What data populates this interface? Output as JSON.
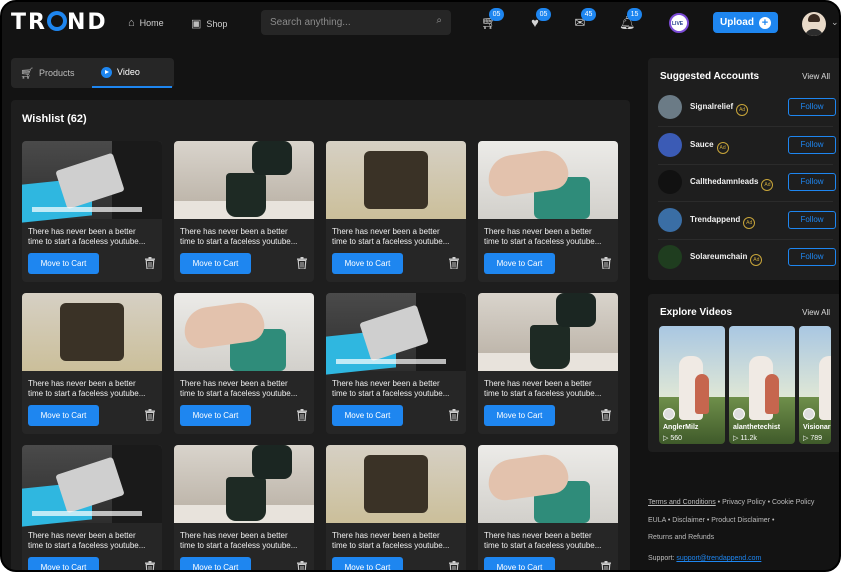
{
  "header": {
    "logo": "TREND",
    "nav": [
      {
        "label": "Home",
        "icon": "home-icon"
      },
      {
        "label": "Shop",
        "icon": "shop-icon"
      }
    ],
    "search_placeholder": "Search anything...",
    "icons": [
      {
        "name": "cart-icon",
        "badge": "05"
      },
      {
        "name": "heart-icon",
        "badge": "05"
      },
      {
        "name": "mail-icon",
        "badge": "45"
      },
      {
        "name": "bell-icon",
        "badge": "15"
      }
    ],
    "live_label": "LIVE",
    "upload_label": "Upload"
  },
  "tabs": [
    {
      "label": "Products",
      "active": false
    },
    {
      "label": "Video",
      "active": true
    }
  ],
  "wishlist": {
    "title": "Wishlist (62)",
    "cards": [
      {
        "thumb": "atm",
        "line1": "There has never been a better",
        "line2": "time to start a faceless youtube...",
        "button": "Move to Cart"
      },
      {
        "thumb": "pour",
        "line1": "There has never been a better",
        "line2": "time to start a faceless youtube...",
        "button": "Move to Cart"
      },
      {
        "thumb": "box",
        "line1": "There has never been a better",
        "line2": "time to start a faceless youtube...",
        "button": "Move to Cart"
      },
      {
        "thumb": "jar",
        "line1": "There has never been a better",
        "line2": "time to start a faceless youtube...",
        "button": "Move to Cart"
      },
      {
        "thumb": "box",
        "line1": "There has never been a better",
        "line2": "time to start a faceless youtube...",
        "button": "Move to Cart"
      },
      {
        "thumb": "jar",
        "line1": "There has never been a better",
        "line2": "time to start a faceless youtube...",
        "button": "Move to Cart"
      },
      {
        "thumb": "atm",
        "line1": "There has never been a better",
        "line2": "time to start a faceless youtube...",
        "button": "Move to Cart"
      },
      {
        "thumb": "pour",
        "line1": "There has never been a better",
        "line2": "time to start a faceless youtube...",
        "button": "Move to Cart"
      },
      {
        "thumb": "atm",
        "line1": "There has never been a better",
        "line2": "time to start a faceless youtube...",
        "button": "Move to Cart"
      },
      {
        "thumb": "pour",
        "line1": "There has never been a better",
        "line2": "time to start a faceless youtube...",
        "button": "Move to Cart"
      },
      {
        "thumb": "box",
        "line1": "There has never been a better",
        "line2": "time to start a faceless youtube...",
        "button": "Move to Cart"
      },
      {
        "thumb": "jar",
        "line1": "There has never been a better",
        "line2": "time to start a faceless youtube...",
        "button": "Move to Cart"
      }
    ]
  },
  "suggested": {
    "title": "Suggested Accounts",
    "view_all": "View All",
    "ad_label": "Ad",
    "follow_label": "Follow",
    "accounts": [
      {
        "name": "Signalrelief",
        "color": "#6b7b86"
      },
      {
        "name": "Sauce",
        "color": "#3b5bb5"
      },
      {
        "name": "Callthedamnleads",
        "color": "#111111"
      },
      {
        "name": "Trendappend",
        "color": "#3a6ea5"
      },
      {
        "name": "Solareumchain",
        "color": "#1f3d1f"
      }
    ]
  },
  "explore": {
    "title": "Explore Videos",
    "view_all": "View All",
    "videos": [
      {
        "name": "AnglerMilz",
        "count": "560"
      },
      {
        "name": "alanthetechist",
        "count": "11.2k"
      },
      {
        "name": "Visionar",
        "count": "789"
      }
    ]
  },
  "footer": {
    "row1": [
      "Terms and Conditions",
      "Privacy Policy",
      "Cookie Policy"
    ],
    "row2": [
      "EULA",
      "Disclaimer",
      "Product Disclaimer"
    ],
    "row3": "Returns and Refunds",
    "support_label": "Support:",
    "support_email": "support@trendappend.com",
    "sep": "•"
  },
  "colors": {
    "accent": "#1e86f0",
    "background": "#131313",
    "panel": "#1e1e1e",
    "card": "#262626"
  }
}
